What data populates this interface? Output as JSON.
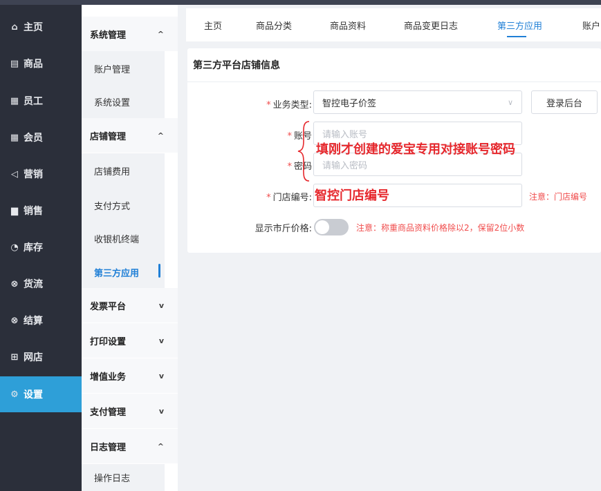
{
  "leftnav": {
    "items": [
      {
        "icon": "home-icon",
        "glyph": "⌂",
        "label": "主页"
      },
      {
        "icon": "goods-icon",
        "glyph": "▤",
        "label": "商品"
      },
      {
        "icon": "staff-icon",
        "glyph": "▦",
        "label": "员工"
      },
      {
        "icon": "member-icon",
        "glyph": "▦",
        "label": "会员"
      },
      {
        "icon": "marketing-icon",
        "glyph": "◁",
        "label": "营销"
      },
      {
        "icon": "sales-icon",
        "glyph": "▆",
        "label": "销售"
      },
      {
        "icon": "inventory-icon",
        "glyph": "◔",
        "label": "库存"
      },
      {
        "icon": "logistics-icon",
        "glyph": "⊗",
        "label": "货流"
      },
      {
        "icon": "settlement-icon",
        "glyph": "⊗",
        "label": "结算"
      },
      {
        "icon": "webshop-icon",
        "glyph": "⊞",
        "label": "网店"
      },
      {
        "icon": "settings-icon",
        "glyph": "⚙",
        "label": "设置"
      }
    ]
  },
  "submenu": {
    "groups": [
      {
        "label": "系统管理",
        "chevron": "^"
      },
      {
        "label": "店铺管理",
        "chevron": "^"
      },
      {
        "label": "发票平台",
        "chevron": "v"
      },
      {
        "label": "打印设置",
        "chevron": "v"
      },
      {
        "label": "增值业务",
        "chevron": "v"
      },
      {
        "label": "支付管理",
        "chevron": "v"
      },
      {
        "label": "日志管理",
        "chevron": "^"
      }
    ],
    "items": [
      {
        "label": "账户管理"
      },
      {
        "label": "系统设置"
      },
      {
        "label": "店铺费用"
      },
      {
        "label": "支付方式"
      },
      {
        "label": "收银机终端"
      },
      {
        "label": "第三方应用"
      },
      {
        "label": "操作日志"
      }
    ]
  },
  "tabs": [
    "主页",
    "商品分类",
    "商品资料",
    "商品变更日志",
    "第三方应用",
    "账户"
  ],
  "card": {
    "title": "第三方平台店铺信息",
    "fields": {
      "business_type_label": "业务类型:",
      "business_type_value": "智控电子价签",
      "login_button": "登录后台",
      "account_label": "账号",
      "account_placeholder": "请输入账号",
      "password_label": "密码",
      "password_placeholder": "请输入密码",
      "store_no_label": "门店编号:",
      "store_no_note": "注意：门店编号",
      "market_price_label": "显示市斤价格:",
      "market_price_note": "注意：称重商品资料价格除以2，保留2位小数"
    },
    "required_mark": "*"
  },
  "annotations": {
    "account_hint": "填刚才创建的爱宝专用对接账号密码",
    "store_hint": "智控门店编号"
  },
  "colors": {
    "accent": "#1f7fd6",
    "nav_active": "#2e9fd8",
    "annotation": "#e6282d",
    "required": "#f04c4c"
  }
}
